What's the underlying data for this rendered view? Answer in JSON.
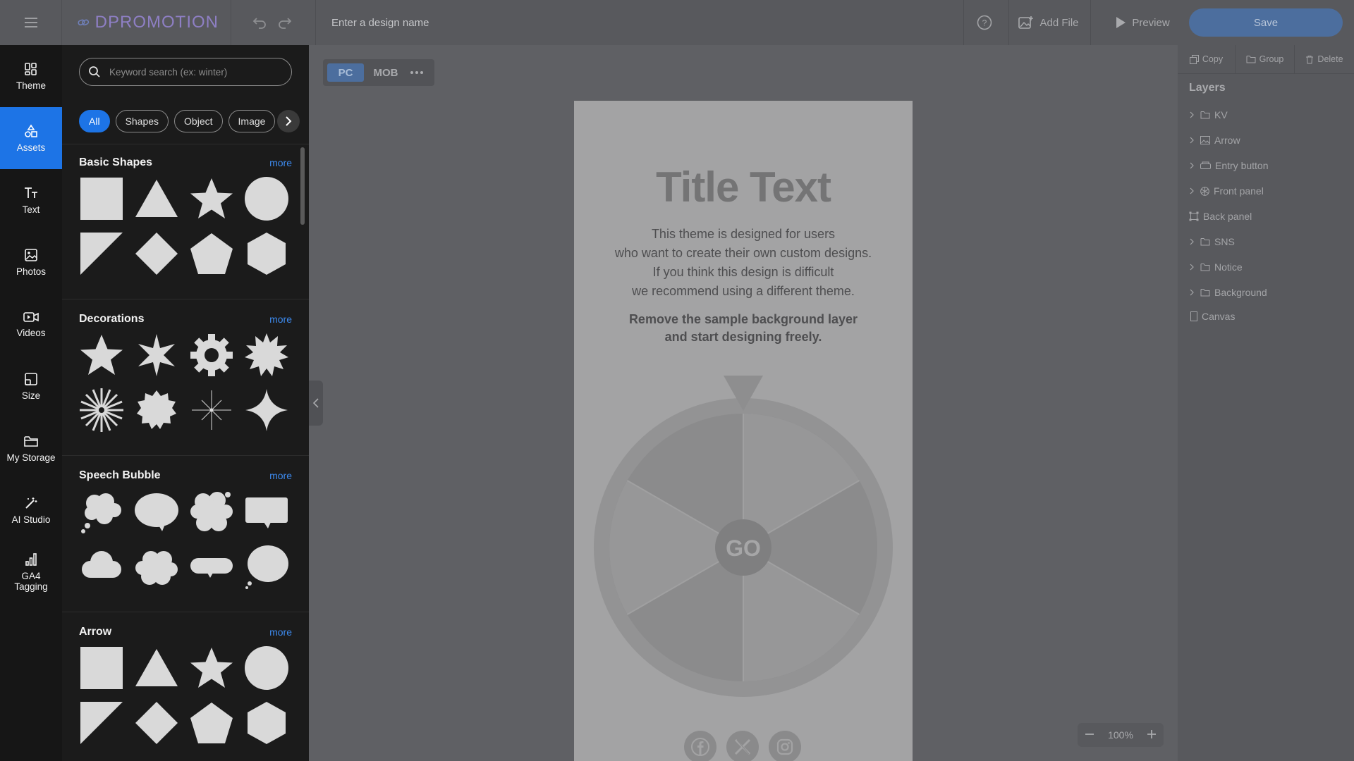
{
  "app": {
    "logo_text": "DPROMOTION",
    "design_name_placeholder": "Enter a design name",
    "add_file_label": "Add File",
    "preview_label": "Preview",
    "save_label": "Save"
  },
  "rail": {
    "items": [
      {
        "label": "Theme",
        "icon": "theme-icon"
      },
      {
        "label": "Assets",
        "icon": "assets-icon",
        "active": true
      },
      {
        "label": "Text",
        "icon": "text-icon"
      },
      {
        "label": "Photos",
        "icon": "photos-icon"
      },
      {
        "label": "Videos",
        "icon": "videos-icon"
      },
      {
        "label": "Size",
        "icon": "size-icon"
      },
      {
        "label": "My Storage",
        "icon": "folder-icon"
      },
      {
        "label": "AI Studio",
        "icon": "magic-wand-icon"
      },
      {
        "label": "GA4 Tagging",
        "icon": "bar-chart-icon"
      }
    ]
  },
  "assets": {
    "search_placeholder": "Keyword search (ex: winter)",
    "chips": [
      "All",
      "Shapes",
      "Object",
      "Image"
    ],
    "active_chip": "All",
    "sections": [
      {
        "title": "Basic Shapes",
        "more": "more"
      },
      {
        "title": "Decorations",
        "more": "more"
      },
      {
        "title": "Speech Bubble",
        "more": "more"
      },
      {
        "title": "Arrow",
        "more": "more"
      }
    ]
  },
  "canvas": {
    "device_pc": "PC",
    "device_mob": "MOB",
    "active_device": "PC",
    "title": "Title Text",
    "description": [
      "This theme is designed for users",
      "who want to create their own custom designs.",
      "If you think this design is difficult",
      "we recommend using a different theme."
    ],
    "emphasis": [
      "Remove the sample background layer",
      "and start designing freely."
    ],
    "wheel_button": "GO",
    "social_icons": [
      "facebook-icon",
      "x-icon",
      "instagram-icon"
    ],
    "zoom": "100%"
  },
  "layers_panel": {
    "tools": [
      "Copy",
      "Group",
      "Delete"
    ],
    "title": "Layers",
    "layers": [
      {
        "name": "KV",
        "type": "folder",
        "expandable": true
      },
      {
        "name": "Arrow",
        "type": "image",
        "expandable": true
      },
      {
        "name": "Entry button",
        "type": "button",
        "expandable": true
      },
      {
        "name": "Front panel",
        "type": "wheel",
        "expandable": true
      },
      {
        "name": "Back panel",
        "type": "frame",
        "expandable": false
      },
      {
        "name": "SNS",
        "type": "folder",
        "expandable": true
      },
      {
        "name": "Notice",
        "type": "folder",
        "expandable": true
      },
      {
        "name": "Background",
        "type": "folder",
        "expandable": true
      },
      {
        "name": "Canvas",
        "type": "canvas",
        "expandable": false
      }
    ]
  },
  "colors": {
    "accent": "#1d74e6",
    "save_button": "#4c6e9e",
    "logo": "#8e7fc4",
    "overlay_bg": "#5f6064"
  }
}
